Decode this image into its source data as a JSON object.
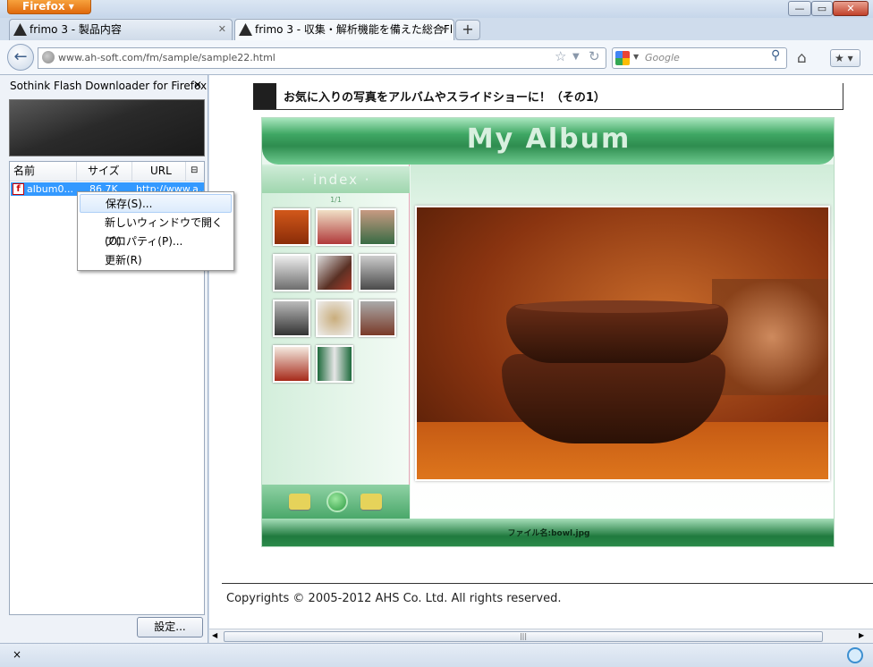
{
  "window": {
    "app_button": "Firefox"
  },
  "tabs": [
    {
      "label": "frimo 3 - 製品内容"
    },
    {
      "label": "frimo 3 - 収集・解析機能を備えた総合Fl..."
    }
  ],
  "navbar": {
    "url": "www.ah-soft.com/fm/sample/sample22.html",
    "search_placeholder": "Google"
  },
  "sidebar": {
    "title": "Sothink Flash Downloader for Firefox",
    "columns": [
      "名前",
      "サイズ",
      "URL"
    ],
    "rows": [
      {
        "name": "album0...",
        "size": "86.7K",
        "url": "http://www.a..."
      }
    ],
    "settings_button": "設定..."
  },
  "context_menu": {
    "items": [
      "保存(S)...",
      "新しいウィンドウで開く(O)",
      "プロパティ(P)...",
      "更新(R)"
    ]
  },
  "page": {
    "heading": "お気に入りの写真をアルバムやスライドショーに！（その1）",
    "flash": {
      "title": "My Album",
      "index_label": "· index ·",
      "page_indicator": "1/1",
      "file_label": "ファイル名:bowl.jpg"
    },
    "copyright": "Copyrights © 2005-2012 AHS Co. Ltd. All rights reserved."
  },
  "statusbar": {
    "close": "×"
  },
  "colors": {
    "firefox_orange": "#e0690c",
    "album_green": "#2e8c4f",
    "selection_blue": "#3399ff"
  }
}
